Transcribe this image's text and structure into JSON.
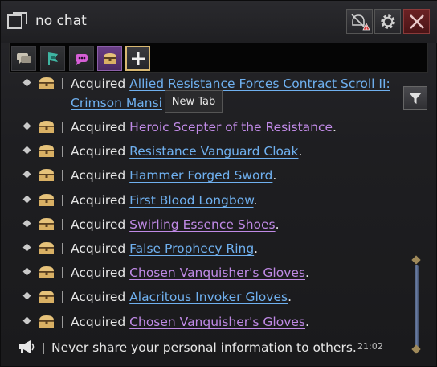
{
  "window": {
    "title": "no chat"
  },
  "titlebar": {
    "alert_icon": "alert-icon",
    "gear_icon": "gear-icon",
    "close_icon": "close-icon"
  },
  "tabs": [
    {
      "icon": "speech-bubbles-icon"
    },
    {
      "icon": "guild-flag-icon"
    },
    {
      "icon": "whisper-bubble-icon"
    },
    {
      "icon": "treasure-chest-icon",
      "selected": true
    },
    {
      "icon": "plus-icon"
    }
  ],
  "tooltip": {
    "text": "New Tab"
  },
  "log": {
    "prefix": "Acquired",
    "partial_top": {
      "item_line1": "Allied Resistance Forces Contract Scroll II:",
      "item_line2": "Crimson Mansi"
    },
    "entries": [
      {
        "item": "Heroic Scepter of the Resistance",
        "suffix": ".",
        "rarity": "purple"
      },
      {
        "item": "Resistance Vanguard Cloak",
        "suffix": ".",
        "rarity": "blue"
      },
      {
        "item": "Hammer Forged Sword",
        "suffix": ".",
        "rarity": "blue"
      },
      {
        "item": "First Blood Longbow",
        "suffix": ".",
        "rarity": "blue"
      },
      {
        "item": "Swirling Essence Shoes",
        "suffix": ".",
        "rarity": "purple"
      },
      {
        "item": "False Prophecy Ring",
        "suffix": ".",
        "rarity": "blue"
      },
      {
        "item": "Chosen Vanquisher's Gloves",
        "suffix": ".",
        "rarity": "purple"
      },
      {
        "item": "Alacritous Invoker Gloves",
        "suffix": ".",
        "rarity": "blue"
      },
      {
        "item": "Chosen Vanquisher's Gloves",
        "suffix": ".",
        "rarity": "purple"
      }
    ]
  },
  "notice": {
    "text": "Never share your personal information to others.",
    "time": "21:02"
  },
  "colors": {
    "item_blue": "#6fb0ef",
    "item_purple": "#c08ae6",
    "selected_tab": "#6a3e86",
    "close_button": "#6b2224"
  }
}
